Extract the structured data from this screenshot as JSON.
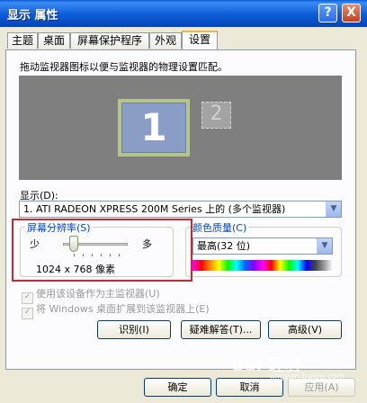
{
  "window": {
    "title": "显示 属性"
  },
  "titlebar": {
    "help_glyph": "?",
    "close_glyph": "X"
  },
  "tabs": [
    {
      "label": "主题",
      "active": false
    },
    {
      "label": "桌面",
      "active": false
    },
    {
      "label": "屏幕保护程序",
      "active": false
    },
    {
      "label": "外观",
      "active": false
    },
    {
      "label": "设置",
      "active": true
    }
  ],
  "settings": {
    "hint": "拖动监视器图标以便与监视器的物理设置匹配。",
    "monitors": {
      "primary": "1",
      "secondary": "2"
    },
    "display_label": "显示(D):",
    "display_value": "1. ATI RADEON XPRESS 200M Series    上的 (多个监视器)",
    "resolution": {
      "legend": "屏幕分辨率(S)",
      "min_label": "少",
      "max_label": "多",
      "value": "1024 x 768 像素",
      "slider_level": 0.15
    },
    "color_quality": {
      "legend": "颜色质量(C)",
      "value": "最高(32 位)"
    },
    "checkboxes": [
      {
        "label": "使用该设备作为主监视器(U)",
        "checked": true,
        "enabled": false
      },
      {
        "label": "将 Windows 桌面扩展到该监视器上(E)",
        "checked": true,
        "enabled": false
      }
    ],
    "buttons": {
      "identify": "识别(I)",
      "troubleshoot": "疑难解答(T)...",
      "advanced": "高级(V)"
    }
  },
  "footer": {
    "ok": "确定",
    "cancel": "取消",
    "apply": "应用(A)"
  },
  "watermark": {
    "text": "Bai 经验",
    "sub": "jingyan.baidu.com"
  },
  "colors": {
    "titlebar": "#0a5fd6",
    "highlight_box": "#c8282e",
    "legend_text": "#0046d5"
  }
}
